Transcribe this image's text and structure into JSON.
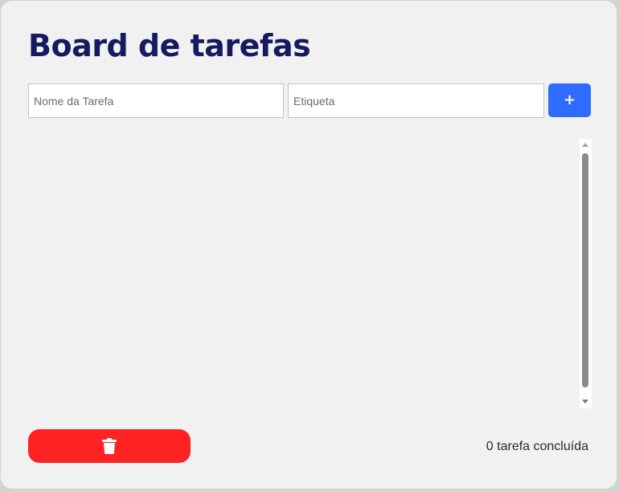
{
  "board": {
    "title": "Board de tarefas"
  },
  "form": {
    "task_name_placeholder": "Nome da Tarefa",
    "task_name_value": "",
    "tag_placeholder": "Etiqueta",
    "tag_value": "",
    "add_label": "+"
  },
  "tasks": [],
  "footer": {
    "delete_icon": "trash-icon",
    "status_text": "0 tarefa concluída"
  },
  "colors": {
    "title": "#161a5e",
    "add_button": "#2f6bff",
    "delete_button": "#ff2222",
    "background": "#f1f1f1"
  }
}
